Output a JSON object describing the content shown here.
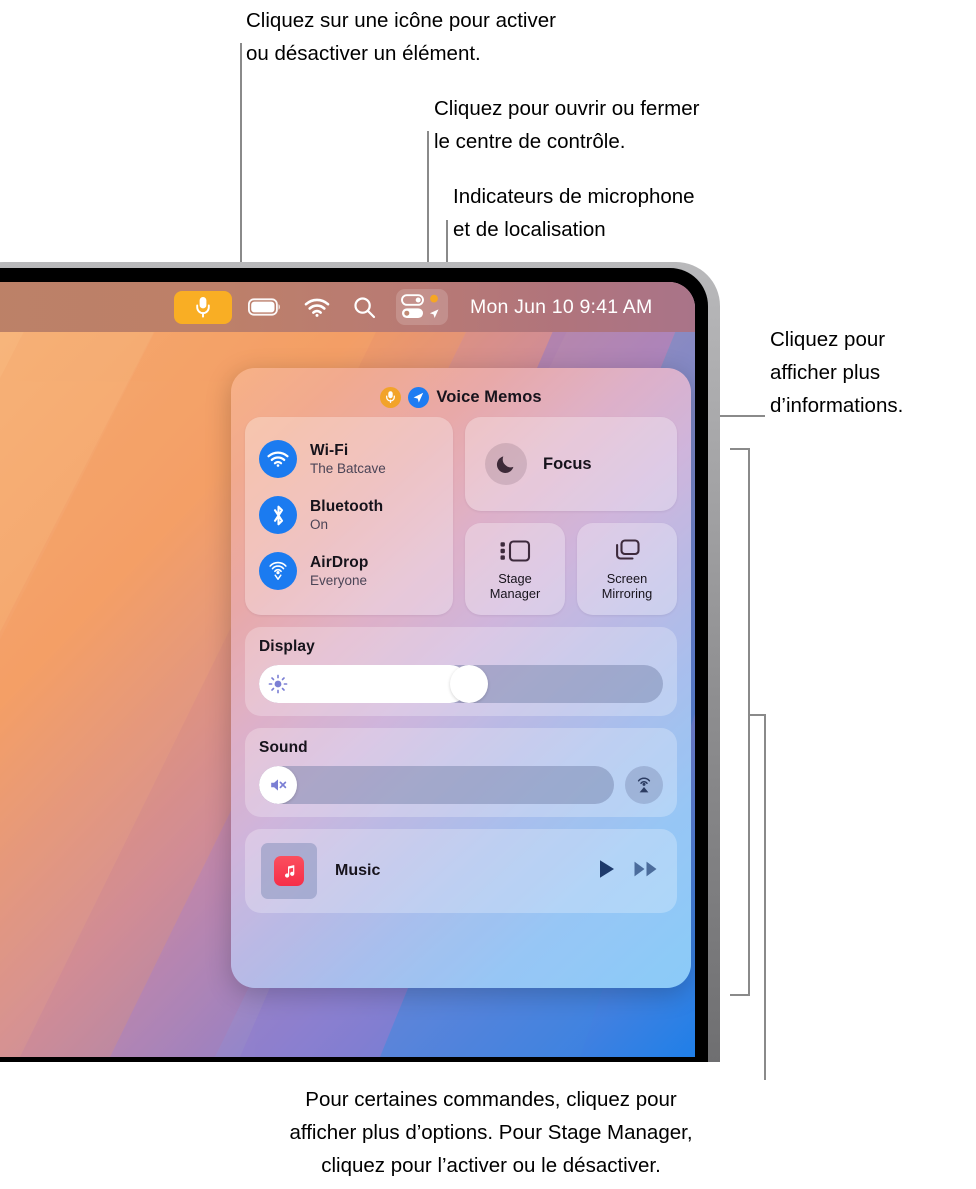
{
  "callouts": {
    "top_left": "Cliquez sur une icône pour activer\nou désactiver un élément.",
    "top_mid": "Cliquez pour ouvrir ou fermer\nle centre de contrôle.",
    "top_right": "Indicateurs de microphone\net de localisation",
    "right": "Cliquez pour\nafficher plus\nd’informations.",
    "bottom": "Pour certaines commandes, cliquez pour\nafficher plus d’options. Pour Stage Manager,\ncliquez pour l’activer ou le désactiver."
  },
  "menubar": {
    "mic_indicator": "microphone-icon",
    "battery": "battery-icon",
    "wifi": "wifi-icon",
    "spotlight": "search-icon",
    "control_center": "control-center-icon",
    "location": "location-arrow-icon",
    "clock": "Mon Jun 10  9:41 AM"
  },
  "control_center": {
    "header": {
      "app": "Voice Memos",
      "mic_dot": "microphone-indicator",
      "location_dot": "location-indicator"
    },
    "connectivity": [
      {
        "name": "Wi-Fi",
        "status": "The Batcave",
        "icon": "wifi-icon"
      },
      {
        "name": "Bluetooth",
        "status": "On",
        "icon": "bluetooth-icon"
      },
      {
        "name": "AirDrop",
        "status": "Everyone",
        "icon": "airdrop-icon"
      }
    ],
    "focus": {
      "label": "Focus",
      "icon": "moon-icon"
    },
    "tiles": [
      {
        "label": "Stage\nManager",
        "icon": "stage-manager-icon"
      },
      {
        "label": "Screen\nMirroring",
        "icon": "screen-mirroring-icon"
      }
    ],
    "display": {
      "label": "Display",
      "value": 52,
      "icon": "brightness-icon"
    },
    "sound": {
      "label": "Sound",
      "value": 0,
      "icon": "mute-icon",
      "output_icon": "airplay-audio-icon"
    },
    "music": {
      "label": "Music",
      "app_icon": "apple-music-icon",
      "play": "play-icon",
      "next": "fast-forward-icon"
    }
  },
  "colors": {
    "accent_blue": "#1b7bf0",
    "mic_orange": "#f9ae24",
    "music_red": "#f62e48",
    "menubar": "#bc8167",
    "leader_line": "#8a8a8a"
  }
}
